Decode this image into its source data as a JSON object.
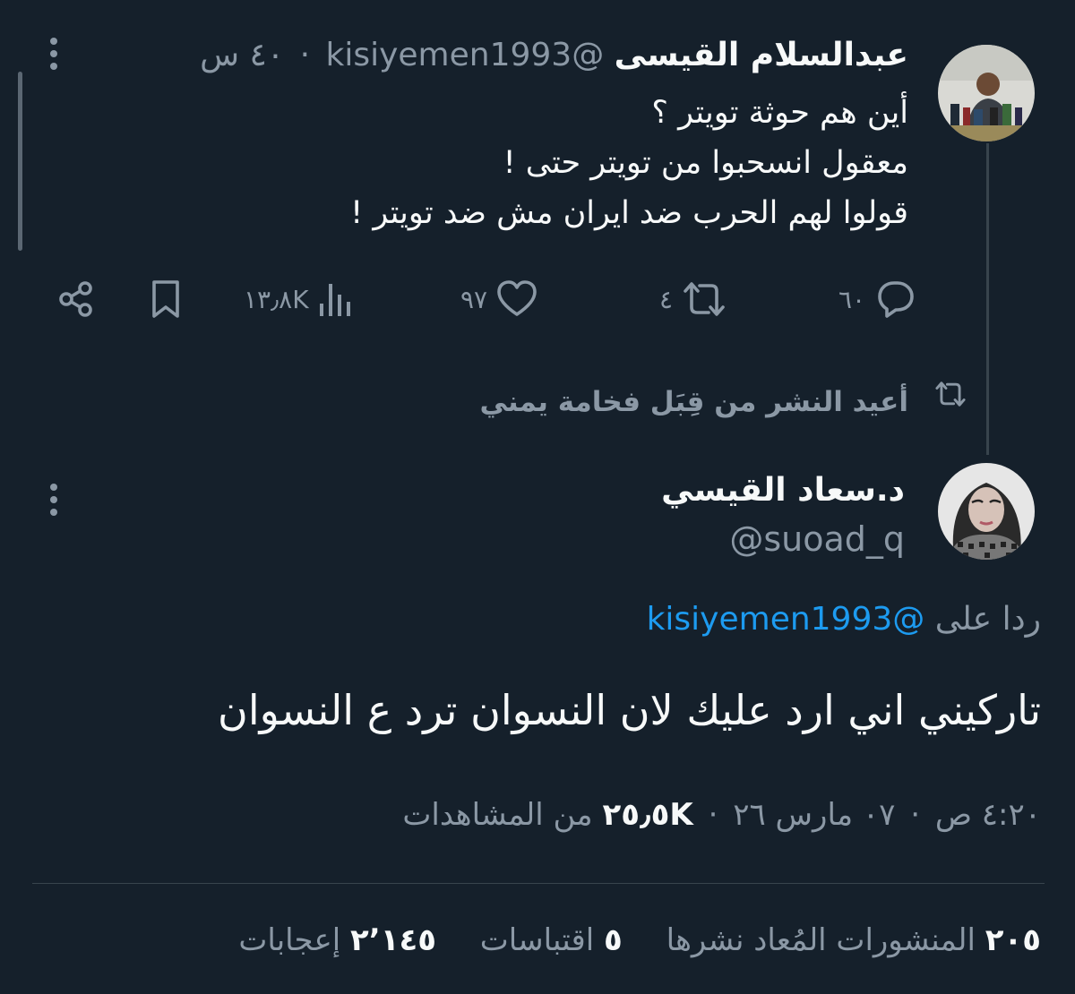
{
  "quoted_tweet": {
    "author_name": "عبدالسلام القيسى",
    "handle": "@kisiyemen1993",
    "time": "٤٠ س",
    "lines": [
      "أين هم حوثة تويتر ؟",
      "معقول انسحبوا من تويتر حتى !",
      "قولوا لهم الحرب ضد ايران مش ضد تويتر !"
    ],
    "actions": {
      "replies": "٦٠",
      "reposts": "٤",
      "likes": "٩٧",
      "views": "١٣٫٨K"
    },
    "icons": [
      "reply-icon",
      "repost-icon",
      "like-icon",
      "views-icon",
      "bookmark-icon",
      "share-icon"
    ]
  },
  "repost_label": "أعيد النشر من قِبَل فخامة يمني",
  "main_tweet": {
    "author_name": "د.سعاد القيسي",
    "handle": "@suoad_q",
    "reply_prefix": "ردا على",
    "reply_handle": "@kisiyemen1993",
    "text": "تاركيني اني ارد عليك لان النسوان ترد ع النسوان",
    "time": "٤:٢٠ ص",
    "date": "٠٧ مارس ٢٦",
    "views_count": "٢٥٫٥K",
    "views_label": "من المشاهدات",
    "stats": {
      "reposts_count": "٢٠٥",
      "reposts_label": "المنشورات المُعاد نشرها",
      "quotes_count": "٥",
      "quotes_label": "اقتباسات",
      "likes_count": "٢٬١٤٥",
      "likes_label": "إعجابات"
    }
  },
  "colors": {
    "background": "#15202b",
    "text": "#f7f9f9",
    "muted": "#8b98a5",
    "link": "#1d9bf0",
    "divider": "#38444d"
  }
}
